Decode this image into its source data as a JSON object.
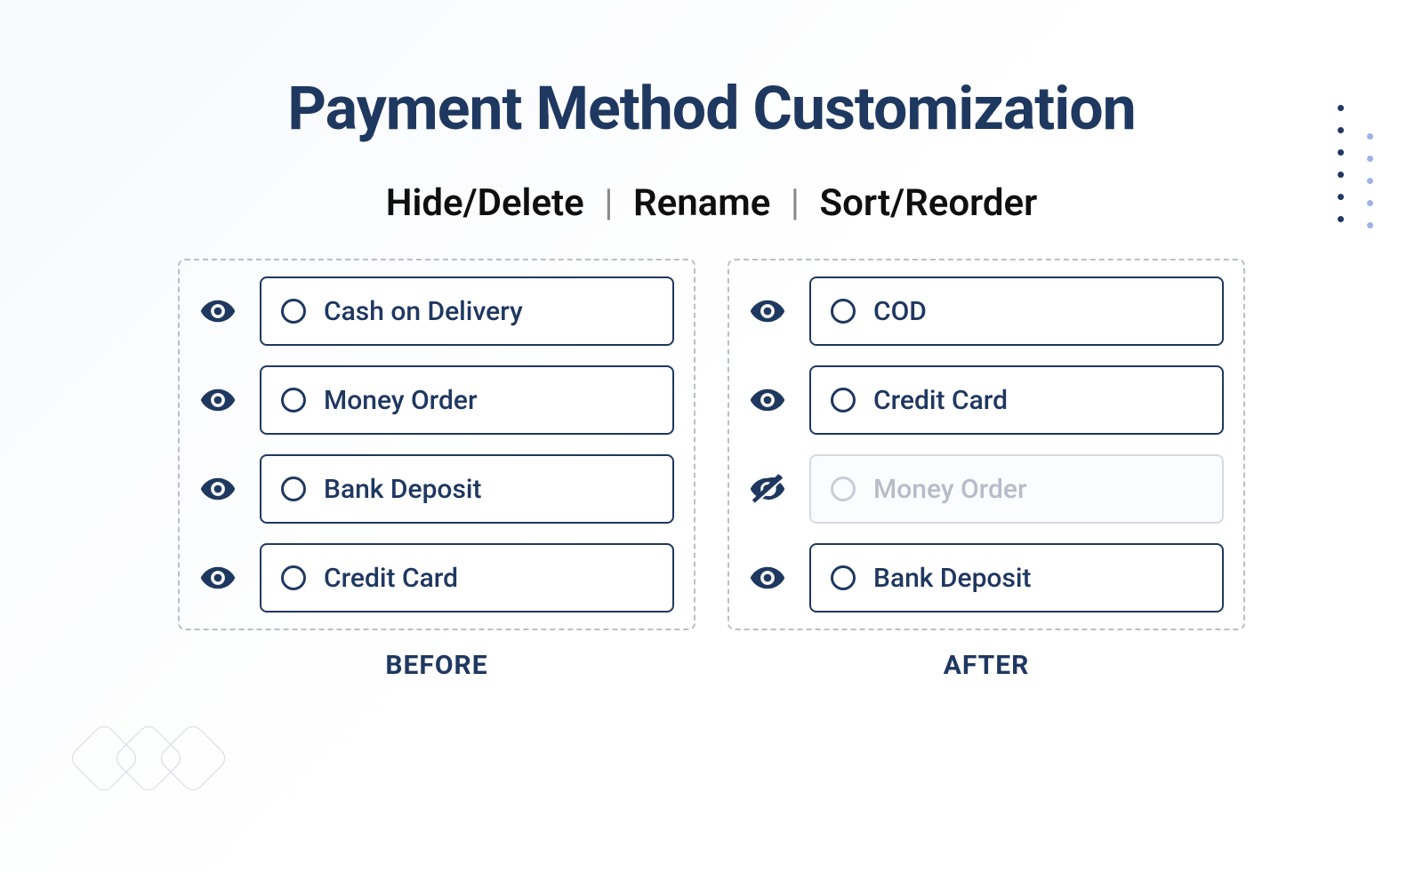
{
  "title": "Payment Method Customization",
  "subtitle": {
    "a": "Hide/Delete",
    "b": "Rename",
    "c": "Sort/Reorder"
  },
  "before": {
    "caption": "BEFORE",
    "items": [
      {
        "label": "Cash on Delivery",
        "visible": true
      },
      {
        "label": "Money Order",
        "visible": true
      },
      {
        "label": "Bank Deposit",
        "visible": true
      },
      {
        "label": "Credit Card",
        "visible": true
      }
    ]
  },
  "after": {
    "caption": "AFTER",
    "items": [
      {
        "label": "COD",
        "visible": true
      },
      {
        "label": "Credit Card",
        "visible": true
      },
      {
        "label": "Money Order",
        "visible": false
      },
      {
        "label": "Bank Deposit",
        "visible": true
      }
    ]
  }
}
